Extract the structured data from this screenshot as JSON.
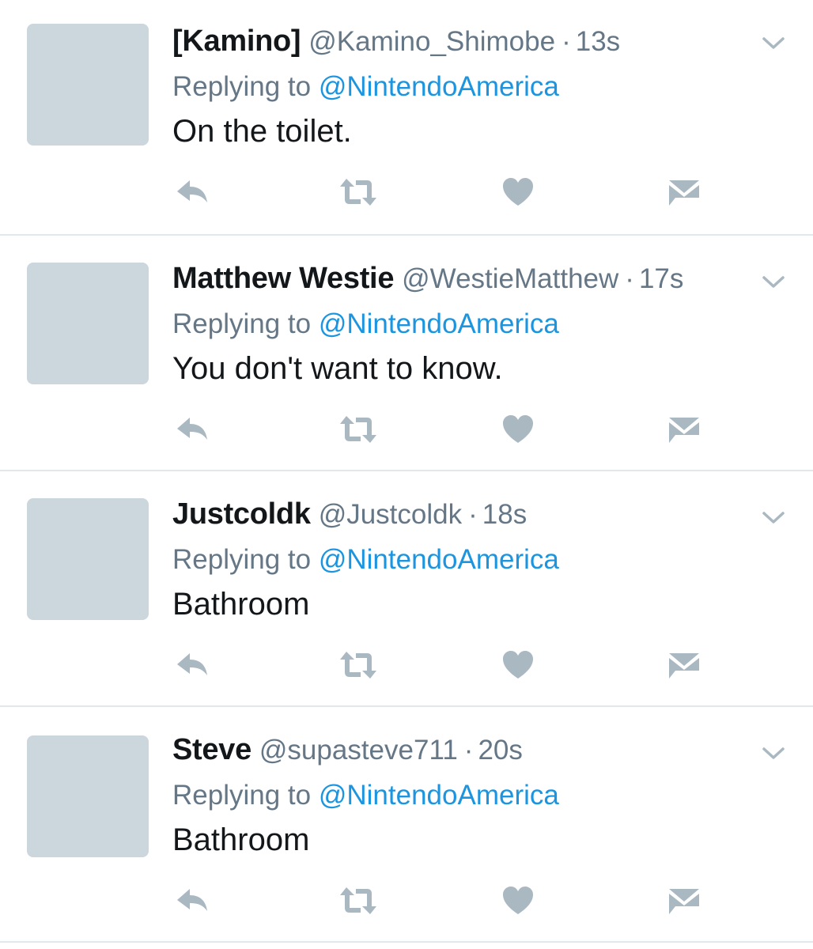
{
  "colors": {
    "name": "#14171a",
    "meta": "#657786",
    "link": "#1b95e0",
    "icon": "#aab8c2",
    "avatar_placeholder": "#ccd6dd",
    "divider": "#e1e8ed"
  },
  "icons": {
    "more": "chevron-down-icon",
    "reply": "reply-icon",
    "retweet": "retweet-icon",
    "like": "heart-icon",
    "dm": "envelope-icon"
  },
  "tweets": [
    {
      "name": "[Kamino]",
      "handle": "@Kamino_Shimobe",
      "separator": "·",
      "time": "13s",
      "reply_prefix": "Replying to",
      "reply_target": "@NintendoAmerica",
      "text": "On the toilet."
    },
    {
      "name": "Matthew Westie",
      "handle": "@WestieMatthew",
      "separator": "·",
      "time": "17s",
      "reply_prefix": "Replying to",
      "reply_target": "@NintendoAmerica",
      "text": "You don't want to know."
    },
    {
      "name": "Justcoldk",
      "handle": "@Justcoldk",
      "separator": "·",
      "time": "18s",
      "reply_prefix": "Replying to",
      "reply_target": "@NintendoAmerica",
      "text": "Bathroom"
    },
    {
      "name": "Steve",
      "handle": "@supasteve711",
      "separator": "·",
      "time": "20s",
      "reply_prefix": "Replying to",
      "reply_target": "@NintendoAmerica",
      "text": "Bathroom"
    }
  ]
}
